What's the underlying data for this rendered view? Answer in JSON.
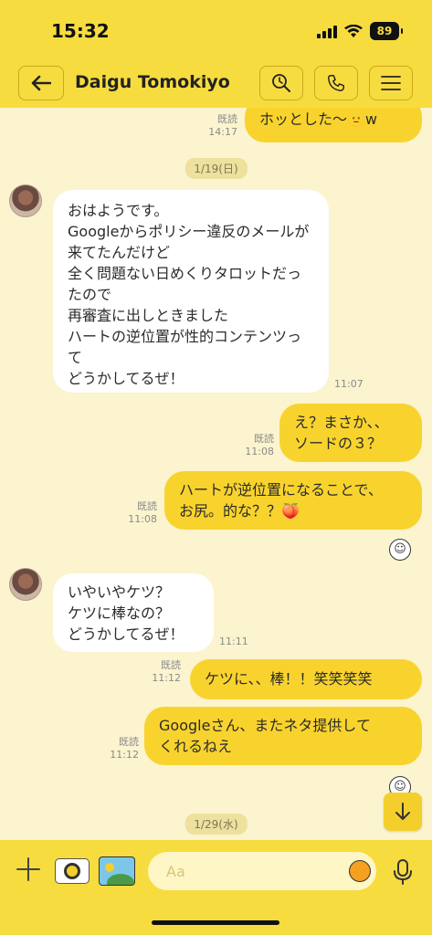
{
  "status_bar": {
    "time": "15:32",
    "battery": "89"
  },
  "header": {
    "title": "Daigu Tomokiyo"
  },
  "messages": [
    {
      "from": "me",
      "text": "ホッとした〜🫥w",
      "read": "既読",
      "time": "14:17"
    },
    {
      "type": "date",
      "text": "1/19(日)"
    },
    {
      "from": "them",
      "text": "おはようです。\nGoogleからポリシー違反のメールが来てたんだけど\n全く問題ない日めくりタロットだったので\n再審査に出しときました\nハートの逆位置が性的コンテンツって\nどうかしてるぜ！",
      "time": "11:07"
    },
    {
      "from": "me",
      "text": "え？まさか、、\nソードの３？",
      "read": "既読",
      "time": "11:08"
    },
    {
      "from": "me",
      "text": "ハートが逆位置になることで、\nお尻。的な？？🍑",
      "read": "既読",
      "time": "11:08"
    },
    {
      "from": "them",
      "text": "いやいやケツ？\nケツに棒なの？\nどうかしてるぜ！",
      "time": "11:11"
    },
    {
      "from": "me",
      "text": "ケツに、、棒！！笑笑笑笑",
      "read": "既読",
      "time": "11:12"
    },
    {
      "from": "me",
      "text": "Googleさん、またネタ提供して\nくれるねえ",
      "read": "既読",
      "time": "11:12"
    },
    {
      "type": "date",
      "text": "1/29(水)"
    }
  ],
  "input": {
    "placeholder": "Aa"
  },
  "colors": {
    "header": "#f7dc3f",
    "chat_bg": "#fbf4cf",
    "my_bubble": "#f9d32d",
    "their_bubble": "#ffffff"
  },
  "icons": [
    "back-arrow-icon",
    "search-icon",
    "phone-icon",
    "menu-icon",
    "plus-icon",
    "camera-icon",
    "image-icon",
    "sticker-icon",
    "mic-icon",
    "arrow-down-icon"
  ]
}
